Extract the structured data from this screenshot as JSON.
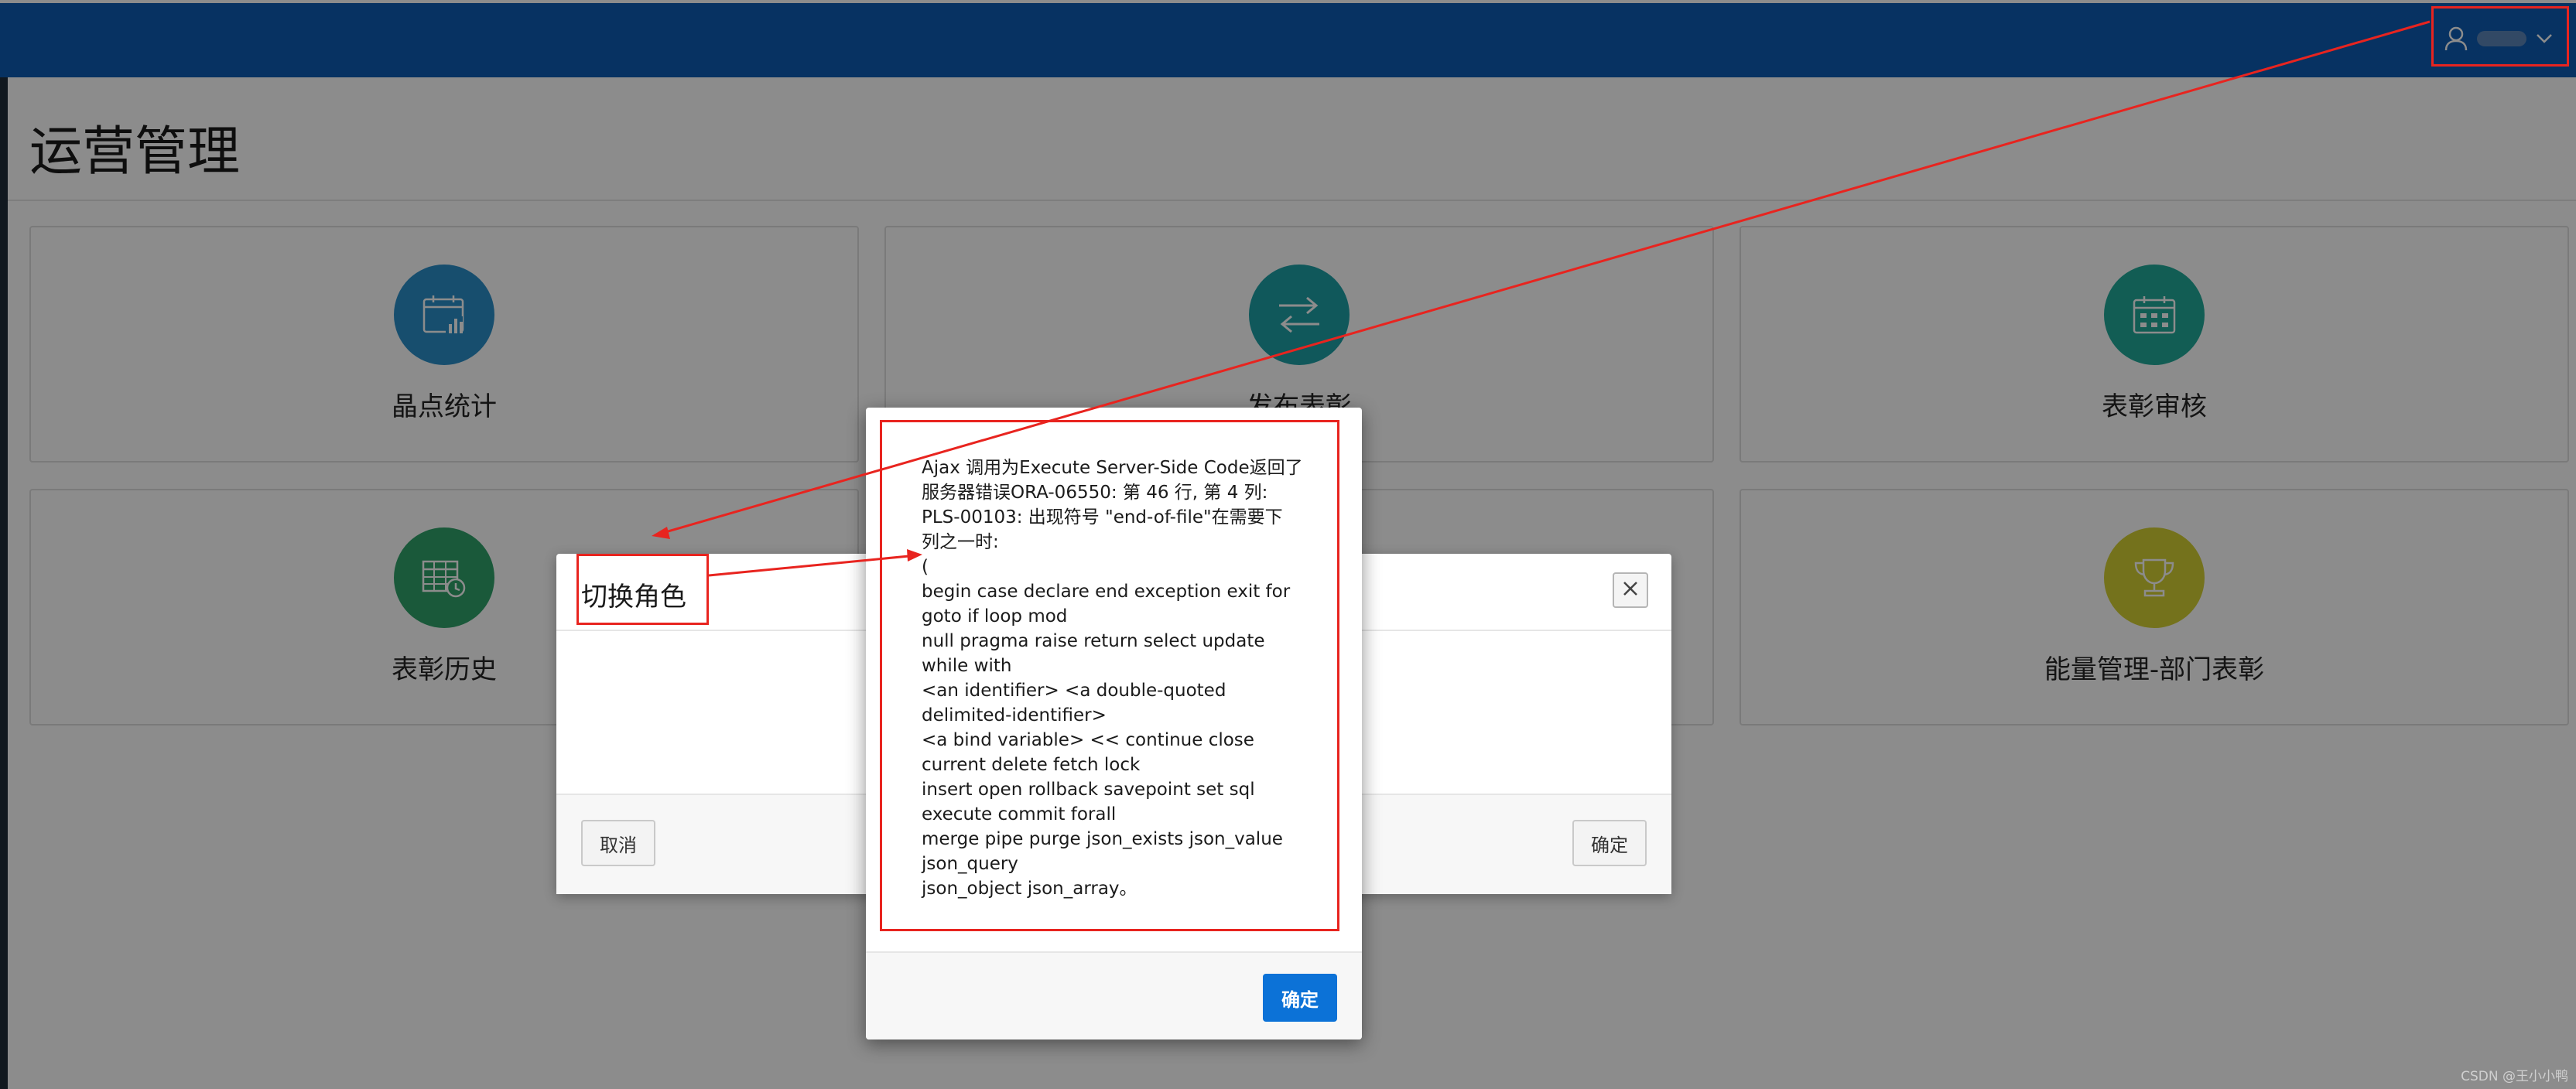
{
  "header": {
    "user_name": "——",
    "user_icon": "user-icon",
    "dropdown_icon": "chevron-down-icon"
  },
  "page": {
    "title": "运营管理"
  },
  "cards": [
    {
      "label": "晶点统计",
      "icon": "calendar-chart-icon",
      "color": "#2b8ec8"
    },
    {
      "label": "发布表彰",
      "icon": "arrows-exchange-icon",
      "color": "#1ea0a6"
    },
    {
      "label": "表彰审核",
      "icon": "calendar-grid-icon",
      "color": "#22a99a"
    },
    {
      "label": "表彰历史",
      "icon": "table-clock-icon",
      "color": "#30a26a"
    },
    {
      "label": "能量管理-部门表彰",
      "icon": "trophy-icon",
      "color": "#d4cf33"
    }
  ],
  "dialog": {
    "title": "切换角色",
    "close_icon": "close-icon",
    "cancel_label": "取消",
    "confirm_label": "确定"
  },
  "alert": {
    "message": "Ajax 调用为Execute Server-Side Code返回了\n服务器错误ORA-06550: 第 46 行, 第 4 列:\nPLS-00103: 出现符号 \"end-of-file\"在需要下\n列之一时:\n(\nbegin case declare end exception exit for\ngoto if loop mod\nnull pragma raise return select update\nwhile with\n<an identifier> <a double-quoted\ndelimited-identifier>\n<a bind variable> << continue close\ncurrent delete fetch lock\ninsert open rollback savepoint set sql\nexecute commit forall\nmerge pipe purge json_exists json_value\njson_query\njson_object json_array。",
    "ok_label": "确定"
  },
  "watermark": "CSDN @王小小鸭",
  "colors": {
    "header_bg": "#0d5cb3",
    "annotation": "#e8241f",
    "primary_button": "#0c72d7"
  }
}
